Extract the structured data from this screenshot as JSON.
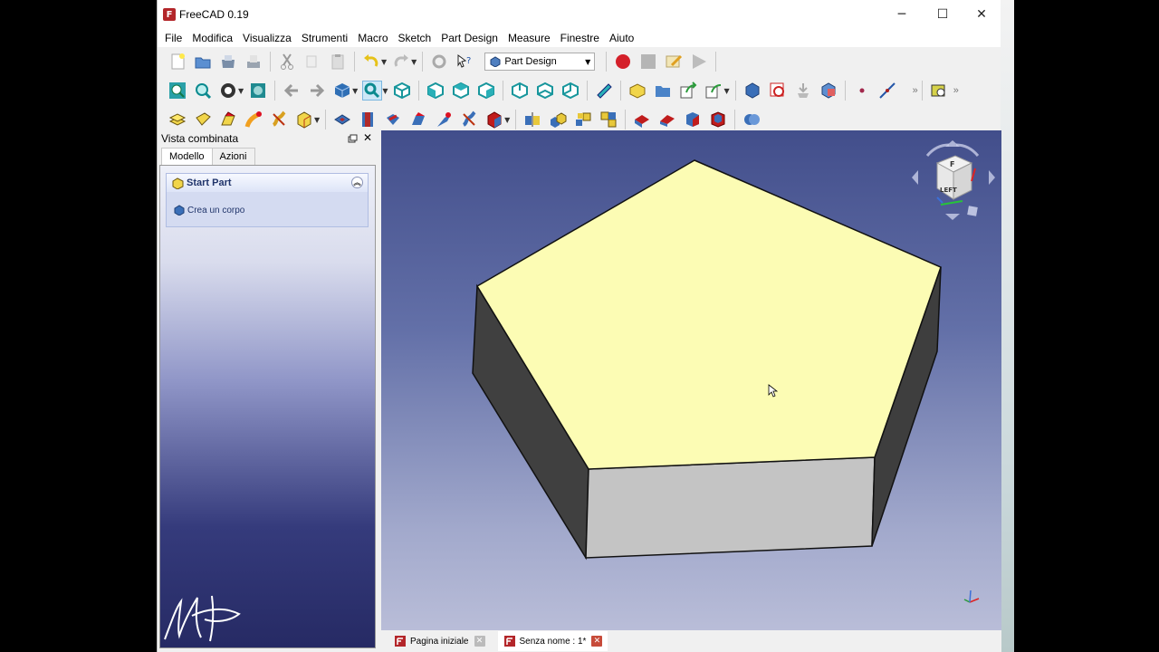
{
  "window": {
    "title": "FreeCAD 0.19",
    "logo_text": "F",
    "controls": {
      "minimize": "─",
      "maximize": "☐",
      "close": "✕"
    }
  },
  "menu": [
    "File",
    "Modifica",
    "Visualizza",
    "Strumenti",
    "Macro",
    "Sketch",
    "Part Design",
    "Measure",
    "Finestre",
    "Aiuto"
  ],
  "toolbar": {
    "workbench_selected": "Part Design",
    "overflow": "»"
  },
  "combo_view": {
    "title": "Vista combinata",
    "tabs": [
      "Modello",
      "Azioni"
    ],
    "active_tab": "Azioni",
    "task": {
      "title": "Start Part",
      "action": "Crea un corpo"
    }
  },
  "document_tabs": [
    {
      "label": "Pagina iniziale",
      "active": false
    },
    {
      "label": "Senza nome : 1*",
      "active": true
    }
  ],
  "nav_cube": {
    "top_label": "F",
    "front_label": "LEFT"
  },
  "colors": {
    "top_face": "#fcfcb4",
    "accent_red": "#d4202a"
  }
}
